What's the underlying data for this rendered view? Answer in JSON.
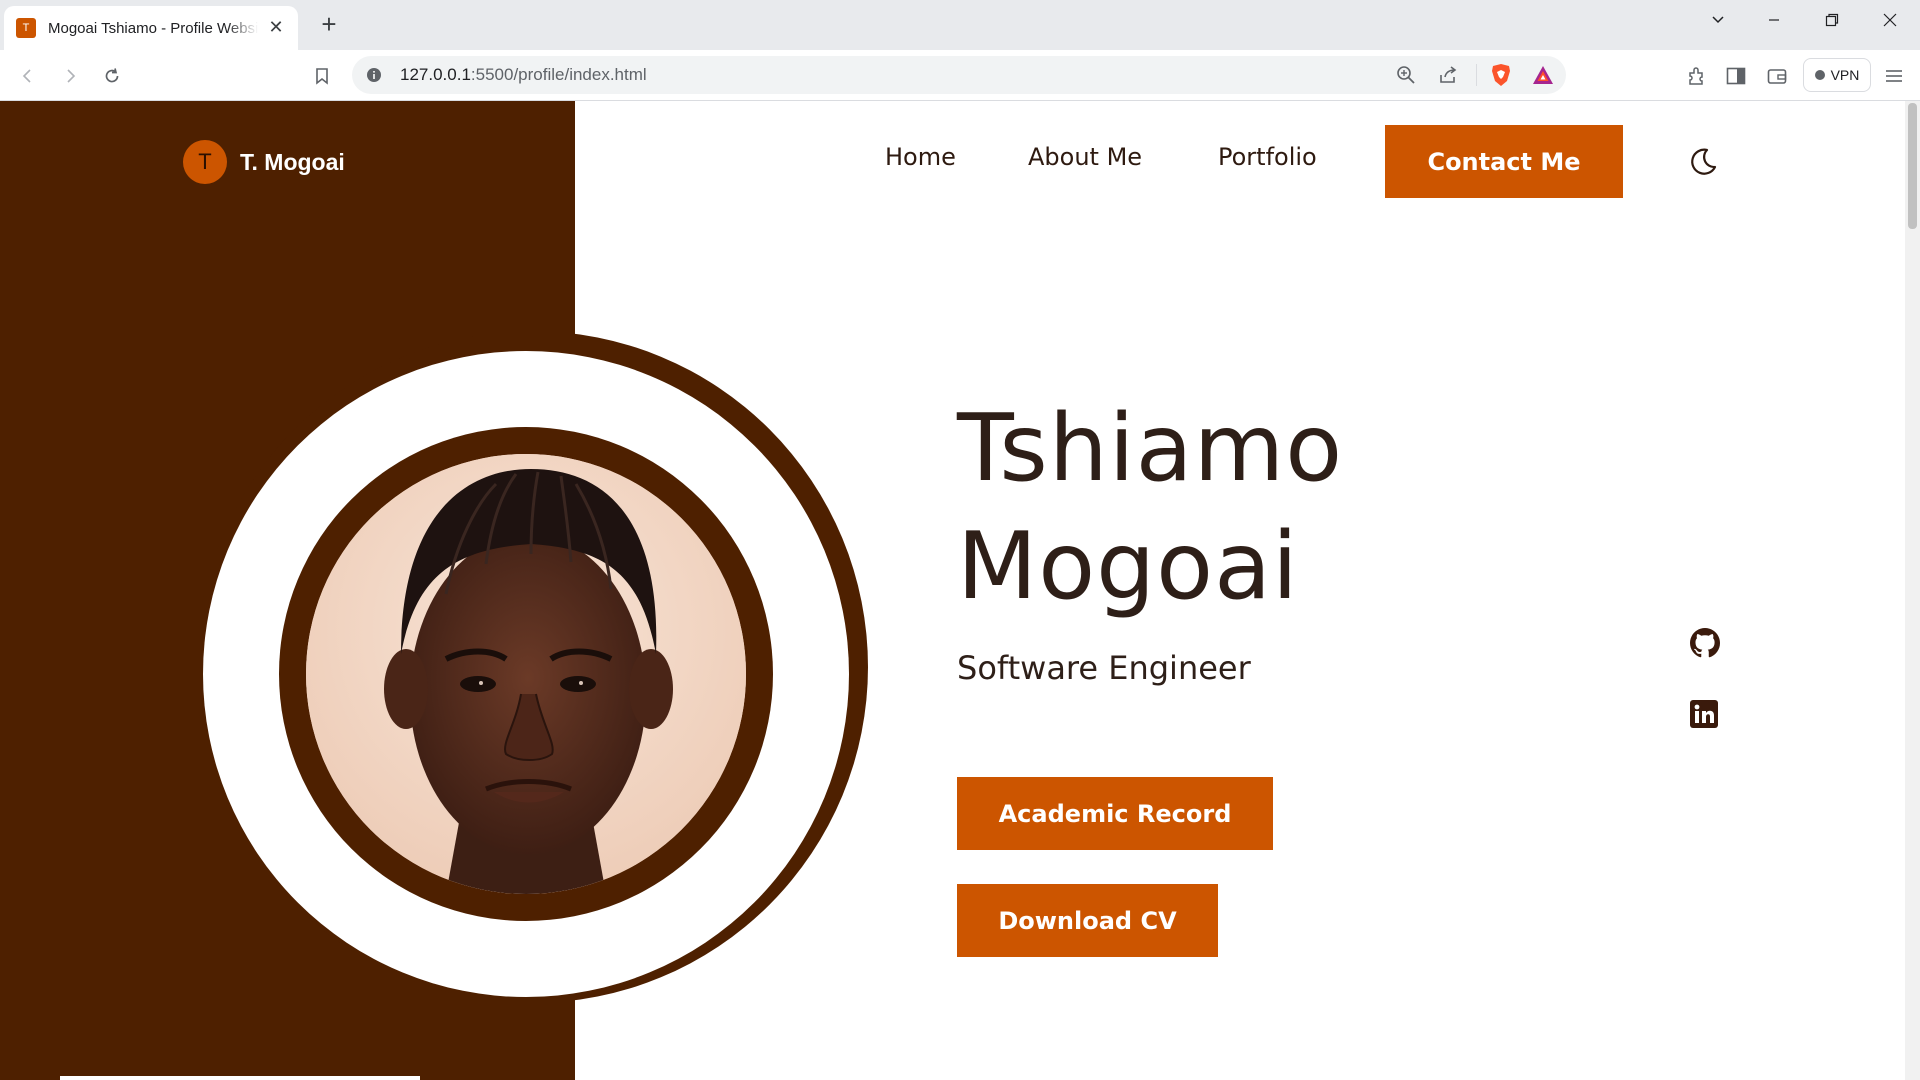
{
  "browser": {
    "tab_title": "Mogoai Tshiamo - Profile Website",
    "favicon_letter": "T",
    "new_tab_symbol": "+",
    "url_host": "127.0.0.1",
    "url_path": ":5500/profile/index.html",
    "vpn_label": "VPN",
    "icons": [
      "back-icon",
      "forward-icon",
      "reload-icon",
      "bookmark-icon",
      "site-info-icon",
      "zoom-icon",
      "share-icon",
      "brave-shields-icon",
      "brave-rewards-icon",
      "extensions-icon",
      "sidebar-icon",
      "wallet-icon",
      "menu-icon",
      "tab-search-icon",
      "minimize-icon",
      "restore-icon",
      "close-icon"
    ]
  },
  "site": {
    "logo_letter": "T",
    "logo_text": "T. Mogoai",
    "nav": {
      "home": "Home",
      "about": "About Me",
      "portfolio": "Portfolio",
      "contact": "Contact Me"
    },
    "hero": {
      "first_name": "Tshiamo",
      "last_name": "Mogoai",
      "role": "Software Engineer",
      "academic_record": "Academic Record",
      "download_cv": "Download CV"
    },
    "colors": {
      "accent": "#cc5500",
      "dark_brown": "#4e2000",
      "text": "#2e1f18"
    }
  }
}
